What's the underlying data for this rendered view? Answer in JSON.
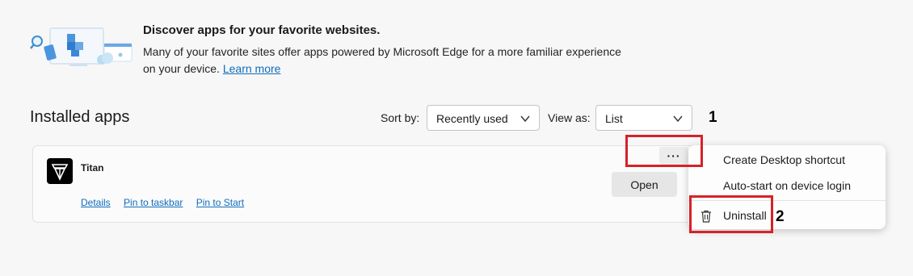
{
  "discover": {
    "title": "Discover apps for your favorite websites.",
    "description": "Many of your favorite sites offer apps powered by Microsoft Edge for a more familiar experience on your device.",
    "learn_more": "Learn more"
  },
  "installed": {
    "title": "Installed apps",
    "sort_label": "Sort by:",
    "sort_value": "Recently used",
    "view_label": "View as:",
    "view_value": "List"
  },
  "app": {
    "name": "Titan",
    "links": [
      "Details",
      "Pin to taskbar",
      "Pin to Start"
    ],
    "open_label": "Open",
    "more_label": "···"
  },
  "menu": {
    "items": [
      "Create Desktop shortcut",
      "Auto-start on device login",
      "Uninstall"
    ]
  },
  "annotations": {
    "step1": "1",
    "step2": "2",
    "highlight_color": "#d62128"
  },
  "colors": {
    "link": "#0f6cbd",
    "background": "#f7f7f7"
  }
}
